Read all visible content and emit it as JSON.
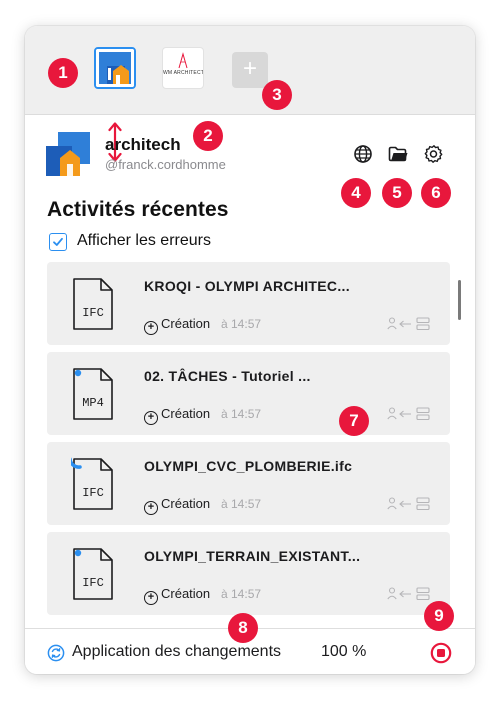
{
  "workspaces": [
    {
      "name": "architech",
      "selected": true
    },
    {
      "name": "WM ARCHITECTES",
      "logo_text": "WM ARCHITECTES",
      "selected": false
    }
  ],
  "add_workspace_symbol": "+",
  "profile": {
    "name": "architech",
    "handle": "@franck.cordhomme"
  },
  "header_icons": [
    "globe-icon",
    "folder-icon",
    "gear-icon"
  ],
  "activities": {
    "title": "Activités récentes",
    "show_errors_label": "Afficher les erreurs",
    "show_errors_checked": true,
    "items": [
      {
        "file_type": "IFC",
        "title": "KROQI - OLYMPI ARCHITEC...",
        "action": "Création",
        "time": "à 14:57",
        "indicator": "none"
      },
      {
        "file_type": "MP4",
        "title": "02. TÂCHES - Tutoriel ...",
        "action": "Création",
        "time": "à 14:57",
        "indicator": "dot"
      },
      {
        "file_type": "IFC",
        "title": "OLYMPI_CVC_PLOMBERIE.ifc",
        "action": "Création",
        "time": "à 14:57",
        "indicator": "arc"
      },
      {
        "file_type": "IFC",
        "title": "OLYMPI_TERRAIN_EXISTANT...",
        "action": "Création",
        "time": "à 14:57",
        "indicator": "dot"
      }
    ]
  },
  "footer": {
    "status": "Application des changements",
    "progress_label": "100 %",
    "progress": 100
  },
  "annotations": [
    "1",
    "2",
    "3",
    "4",
    "5",
    "6",
    "7",
    "8",
    "9"
  ],
  "colors": {
    "accent": "#2b8ff0",
    "badge": "#e8173c",
    "stop": "#e8173c",
    "card_bg": "#efefef",
    "topbar_bg": "#efefef"
  }
}
